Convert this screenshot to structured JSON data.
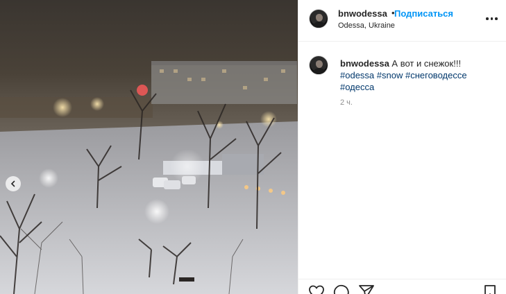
{
  "post": {
    "username": "bnwodessa",
    "separator": "•",
    "follow_label": "Подписаться",
    "location": "Odessa, Ukraine",
    "more_icon": "more-horizontal-icon"
  },
  "caption": {
    "username": "bnwodessa",
    "text": "А вот и снежок!!!",
    "hashtags": [
      "#odessa",
      "#snow",
      "#снеговодессе",
      "#одесса"
    ],
    "time": "2 ч."
  },
  "photo": {
    "description_icon": "snowy-night-city-photo",
    "nav_icon": "chevron-left-icon"
  },
  "actions": {
    "icons": [
      "heart-icon",
      "comment-icon",
      "share-icon",
      "bookmark-icon"
    ]
  },
  "colors": {
    "follow": "#0095f6",
    "hashtag": "#00376b",
    "text": "#262626",
    "muted": "#8e8e8e",
    "border": "#efefef"
  }
}
